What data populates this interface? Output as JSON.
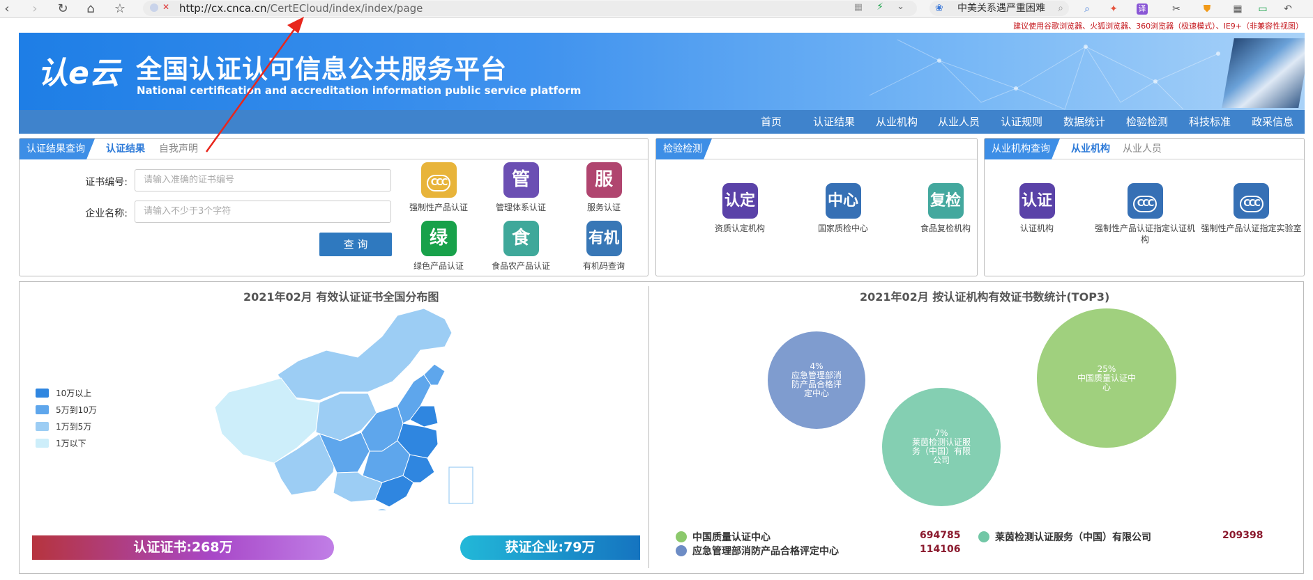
{
  "browser": {
    "url_host": "http://cx.cnca.cn",
    "url_path": "/CertECloud/index/index/page",
    "search_text": "中美关系遇严重困难",
    "icons": [
      "back-icon",
      "forward-icon",
      "reload-icon",
      "home-icon",
      "star-icon",
      "grid-icon",
      "chevron-down-icon",
      "paw-icon",
      "search-icon",
      "game-icon",
      "translate-icon",
      "scissors-icon",
      "shield-icon",
      "apps-icon",
      "battery-icon",
      "undo-icon"
    ]
  },
  "notice": "建议使用谷歌浏览器、火狐浏览器、360浏览器（极速模式）、IE9+（非兼容性视图）",
  "banner": {
    "logo": "认e云",
    "title": "全国认证认可信息公共服务平台",
    "subtitle": "National certification and accreditation information public service platform"
  },
  "nav": [
    "首页",
    "认证结果",
    "从业机构",
    "从业人员",
    "认证规则",
    "数据统计",
    "检验检测",
    "科技标准",
    "政采信息"
  ],
  "panel1": {
    "tab_main": "认证结果查询",
    "tab_active": "认证结果",
    "tab_other": "自我声明",
    "cert_label": "证书编号:",
    "cert_placeholder": "请输入准确的证书编号",
    "company_label": "企业名称:",
    "company_placeholder": "请输入不少于3个字符",
    "query_btn": "查  询",
    "tiles": [
      {
        "icon": "CCC",
        "label": "强制性产品认证",
        "color": "#e8b43a"
      },
      {
        "icon": "管",
        "label": "管理体系认证",
        "color": "#6b4fb3"
      },
      {
        "icon": "服",
        "label": "服务认证",
        "color": "#b0456f"
      },
      {
        "icon": "绿",
        "label": "绿色产品认证",
        "color": "#18a14a"
      },
      {
        "icon": "食",
        "label": "食品农产品认证",
        "color": "#3fa89a"
      },
      {
        "icon": "有机",
        "label": "有机码查询",
        "color": "#3877b6"
      }
    ]
  },
  "panel2": {
    "tab_main": "检验检测",
    "tiles": [
      {
        "icon": "认定",
        "label": "资质认定机构",
        "color": "#5a42a8"
      },
      {
        "icon": "中心",
        "label": "国家质检中心",
        "color": "#3670b5"
      },
      {
        "icon": "复检",
        "label": "食品复检机构",
        "color": "#43a89e"
      }
    ]
  },
  "panel3": {
    "tab_main": "从业机构查询",
    "tab_active": "从业机构",
    "tab_other": "从业人员",
    "tiles": [
      {
        "icon": "认证",
        "label": "认证机构",
        "color": "#5a42a8"
      },
      {
        "icon": "CCC",
        "label": "强制性产品认证指定认证机构",
        "color": "#3670b5"
      },
      {
        "icon": "CCC",
        "label": "强制性产品认证指定实验室",
        "color": "#3670b5"
      }
    ]
  },
  "map_section": {
    "title": "2021年02月  有效认证证书全国分布图",
    "legend": [
      {
        "label": "10万以上",
        "color": "#2f86e0"
      },
      {
        "label": "5万到10万",
        "color": "#5ea6ec"
      },
      {
        "label": "1万到5万",
        "color": "#9ccdf4"
      },
      {
        "label": "1万以下",
        "color": "#cdeefa"
      }
    ],
    "cert_pill": "认证证书:268万",
    "company_pill": "获证企业:79万"
  },
  "chart_data": {
    "type": "bubble",
    "title": "2021年02月   按认证机构有效证书数统计(TOP3)",
    "series": [
      {
        "name": "中国质量认证中心",
        "value": 694785,
        "percent": "25%",
        "label": "中国质量认证中心",
        "color": "#8cc96c"
      },
      {
        "name": "莱茵检测认证服务（中国）有限公司",
        "value": 209398,
        "percent": "7%",
        "label": "莱茵检测认证服务（中国）有限公司",
        "color": "#72c7a6"
      },
      {
        "name": "应急管理部消防产品合格评定中心",
        "value": 114106,
        "percent": "4%",
        "label": "应急管理部消防产品合格评定中心",
        "color": "#6d8cc5"
      }
    ]
  }
}
